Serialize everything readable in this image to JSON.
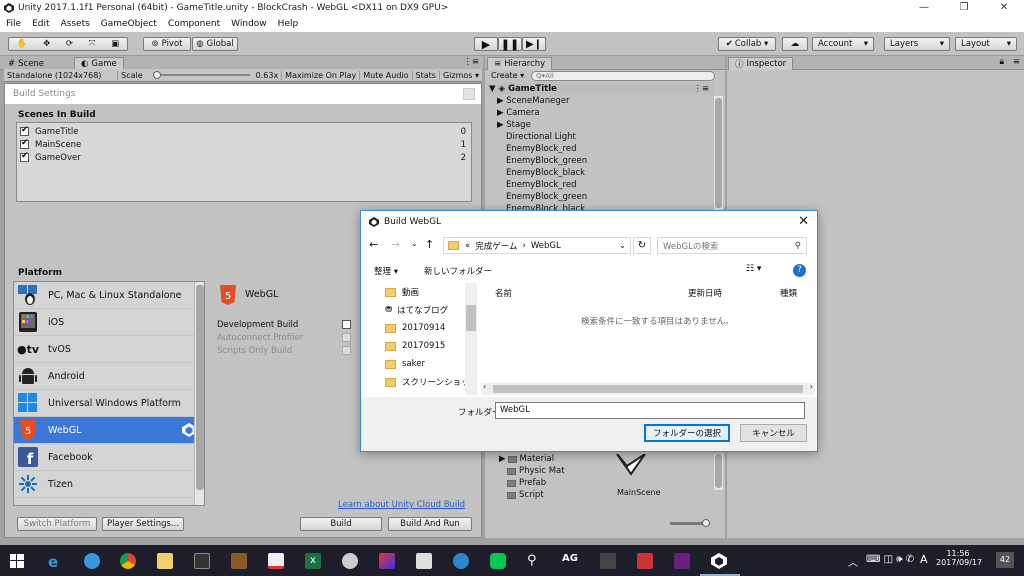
{
  "window": {
    "title": "Unity 2017.1.1f1 Personal (64bit) - GameTitle.unity - BlockCrash - WebGL <DX11 on DX9 GPU>",
    "minimize": "—",
    "maximize": "❐",
    "close": "✕"
  },
  "menu": [
    "File",
    "Edit",
    "Assets",
    "GameObject",
    "Component",
    "Window",
    "Help"
  ],
  "toolbar": {
    "pivot": "Pivot",
    "global": "Global",
    "collab": "Collab ▾",
    "account": "Account",
    "layers": "Layers",
    "layout": "Layout"
  },
  "tabs": {
    "scene": "Scene",
    "game": "Game",
    "hierarchy": "Hierarchy",
    "inspector": "Inspector"
  },
  "gamebar": {
    "resolution": "Standalone (1024x768)",
    "scale_label": "Scale",
    "scale_value": "0.63x",
    "maximize": "Maximize On Play",
    "mute": "Mute Audio",
    "stats": "Stats",
    "gizmos": "Gizmos ▾"
  },
  "hierarchy": {
    "create": "Create ▾",
    "search_placeholder": "Q▾All",
    "root": "GameTitle",
    "items": [
      {
        "label": "SceneManeger",
        "arrow": true
      },
      {
        "label": "Camera",
        "arrow": true
      },
      {
        "label": "Stage",
        "arrow": true
      },
      {
        "label": "Directional Light",
        "arrow": false
      },
      {
        "label": "EnemyBlock_red",
        "arrow": false
      },
      {
        "label": "EnemyBlock_green",
        "arrow": false
      },
      {
        "label": "EnemyBlock_black",
        "arrow": false
      },
      {
        "label": "EnemyBlock_red",
        "arrow": false
      },
      {
        "label": "EnemyBlock_green",
        "arrow": false
      },
      {
        "label": "EnemyBlock_black",
        "arrow": false
      }
    ]
  },
  "project": {
    "folders": [
      "Material",
      "Physic Mat",
      "Prefab",
      "Script"
    ],
    "asset": "MainScene"
  },
  "build_settings": {
    "title": "Build Settings",
    "scenes_header": "Scenes In Build",
    "scenes": [
      {
        "name": "GameTitle",
        "index": "0"
      },
      {
        "name": "MainScene",
        "index": "1"
      },
      {
        "name": "GameOver",
        "index": "2"
      }
    ],
    "platform_header": "Platform",
    "platforms": [
      {
        "name": "PC, Mac & Linux Standalone",
        "icon": "windows-linux-icon"
      },
      {
        "name": "iOS",
        "icon": "ios-icon"
      },
      {
        "name": "tvOS",
        "icon": "tvos-icon"
      },
      {
        "name": "Android",
        "icon": "android-icon"
      },
      {
        "name": "Universal Windows Platform",
        "icon": "windows-icon"
      },
      {
        "name": "WebGL",
        "icon": "html5-icon"
      },
      {
        "name": "Facebook",
        "icon": "facebook-icon"
      },
      {
        "name": "Tizen",
        "icon": "tizen-icon"
      }
    ],
    "selected_platform": "WebGL",
    "platform_title": "WebGL",
    "html5_badge": "5",
    "options": [
      {
        "label": "Development Build",
        "enabled": true
      },
      {
        "label": "Autoconnect Profiler",
        "enabled": false
      },
      {
        "label": "Scripts Only Build",
        "enabled": false
      }
    ],
    "cloud_link": "Learn about Unity Cloud Build",
    "switch_platform": "Switch Platform",
    "player_settings": "Player Settings...",
    "build": "Build",
    "build_and_run": "Build And Run"
  },
  "folder_dialog": {
    "title": "Build WebGL",
    "address": [
      "«",
      "完成ゲーム",
      "›",
      "WebGL"
    ],
    "search_placeholder": "WebGLの検索",
    "organize": "整理 ▾",
    "new_folder": "新しいフォルダー",
    "nav": [
      "動画",
      "はてなブログ",
      "20170914",
      "20170915",
      "saker",
      "スクリーンショット"
    ],
    "columns": [
      "名前",
      "更新日時",
      "種類"
    ],
    "empty_message": "検索条件に一致する項目はありません。",
    "folder_label": "フォルダー:",
    "folder_value": "WebGL",
    "select_button": "フォルダーの選択",
    "cancel_button": "キャンセル"
  },
  "taskbar": {
    "time": "11:56",
    "date": "2017/09/17",
    "ime": "A",
    "notifications": "42",
    "ag": "AG"
  }
}
